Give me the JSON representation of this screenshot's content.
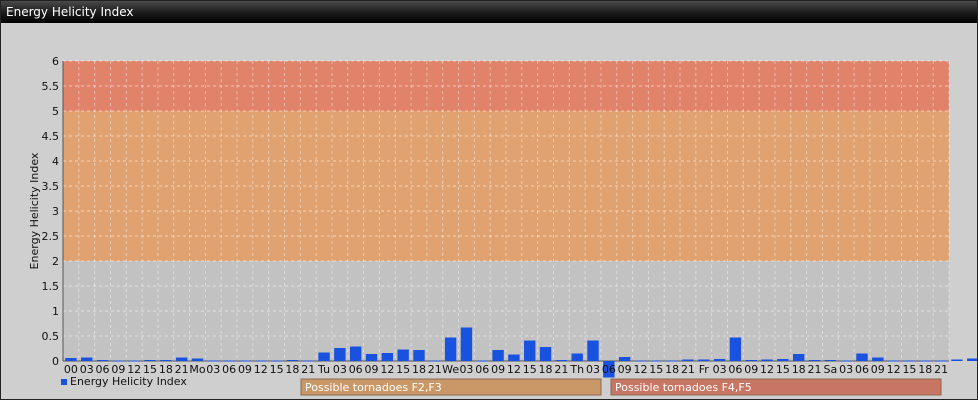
{
  "window": {
    "title": "Energy Helicity Index"
  },
  "chart_data": {
    "type": "bar",
    "ylabel": "Energy Helicity Index",
    "ylim": [
      0,
      6
    ],
    "yticks": [
      "0",
      "0.5",
      "1",
      "1.5",
      "2",
      "2.5",
      "3",
      "3.5",
      "4",
      "4.5",
      "5",
      "5.5",
      "6"
    ],
    "grid": true,
    "categories": [
      "00",
      "03",
      "06",
      "09",
      "12",
      "15",
      "18",
      "21",
      "Mo",
      "03",
      "06",
      "09",
      "12",
      "15",
      "18",
      "21",
      "Tu",
      "03",
      "06",
      "09",
      "12",
      "15",
      "18",
      "21",
      "We",
      "03",
      "06",
      "09",
      "12",
      "15",
      "18",
      "21",
      "Th",
      "03",
      "06",
      "09",
      "12",
      "15",
      "18",
      "21",
      "Fr",
      "03",
      "06",
      "09",
      "12",
      "15",
      "18",
      "21",
      "Sa",
      "03",
      "06",
      "09",
      "12",
      "15",
      "18",
      "21"
    ],
    "series": [
      {
        "name": "Energy Helicity Index",
        "color": "#1a52e0",
        "values": [
          0.06,
          0.07,
          0.02,
          0.01,
          0.01,
          0.02,
          0.02,
          0.07,
          0.05,
          0.01,
          0.01,
          0.01,
          0.01,
          0.01,
          0.02,
          0.01,
          0.17,
          0.26,
          0.29,
          0.14,
          0.16,
          0.23,
          0.22,
          0.01,
          0.47,
          0.67,
          0.01,
          0.22,
          0.13,
          0.41,
          0.28,
          0.02,
          0.15,
          0.41,
          -0.33,
          0.08,
          0.01,
          0.01,
          0.01,
          0.03,
          0.03,
          0.04,
          0.47,
          0.02,
          0.03,
          0.04,
          0.14,
          0.02,
          0.02,
          0.01,
          0.15,
          0.07,
          0.01,
          0.01,
          0.01,
          0.01,
          0.03,
          0.05,
          0.25
        ]
      }
    ],
    "bands": [
      {
        "from": 0,
        "to": 2,
        "color": "#c2c2c2"
      },
      {
        "from": 2,
        "to": 5,
        "color": "#dfa270"
      },
      {
        "from": 5,
        "to": 6,
        "color": "#e0836a"
      }
    ],
    "legend": {
      "label": "Energy Helicity Index",
      "position": "bottom-left"
    },
    "annotations": [
      {
        "label": "Possible tornadoes F2,F3",
        "color": "#c99866"
      },
      {
        "label": "Possible tornadoes F4,F5",
        "color": "#c97563"
      }
    ]
  }
}
